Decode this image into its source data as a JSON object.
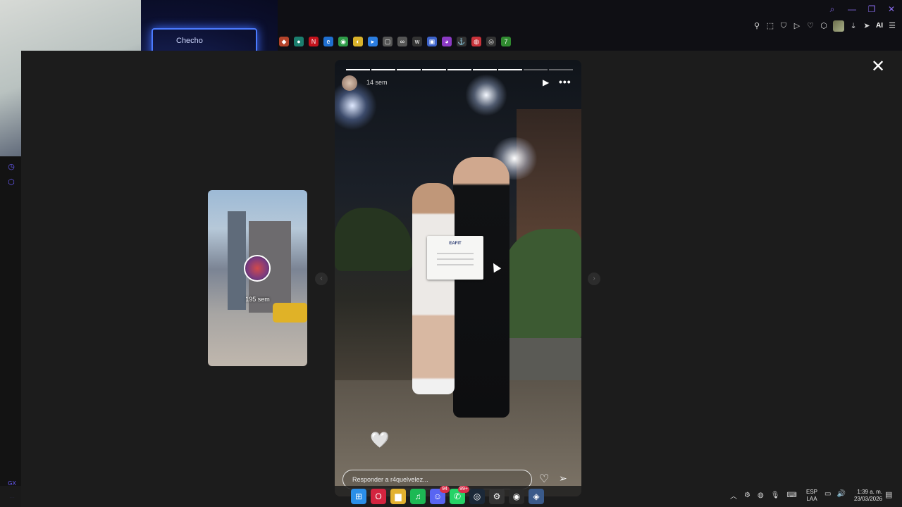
{
  "window_controls": [
    {
      "name": "search-icon",
      "glyph": "⌕"
    },
    {
      "name": "minimize-icon",
      "glyph": "—"
    },
    {
      "name": "restore-icon",
      "glyph": "❐"
    },
    {
      "name": "close-window-icon",
      "glyph": "✕"
    }
  ],
  "toolbar": {
    "icons": [
      {
        "name": "pin-icon",
        "glyph": "⚲"
      },
      {
        "name": "snapshot-icon",
        "glyph": "⬚"
      },
      {
        "name": "shield-icon",
        "glyph": "⛉"
      },
      {
        "name": "play-icon",
        "glyph": "▷"
      },
      {
        "name": "heart-icon",
        "glyph": "♡"
      },
      {
        "name": "extensions-icon",
        "glyph": "⬡"
      }
    ],
    "ai_label": "AI",
    "menu_glyph": "☰",
    "download_glyph": "⤓",
    "send_glyph": "➤"
  },
  "bookmarks": [
    {
      "name": "bookmark-a-icon",
      "glyph": "◆",
      "color": "#b4432a"
    },
    {
      "name": "bookmark-b-icon",
      "glyph": "●",
      "color": "#1b7e6e"
    },
    {
      "name": "netflix-icon",
      "glyph": "N",
      "color": "#c4121c"
    },
    {
      "name": "edge-icon",
      "glyph": "e",
      "color": "#1f6fd1"
    },
    {
      "name": "chrome-icon",
      "glyph": "◉",
      "color": "#2e9b48"
    },
    {
      "name": "bookmark-c-icon",
      "glyph": "◐",
      "color": "#d9b22a"
    },
    {
      "name": "bookmark-d-icon",
      "glyph": "▸",
      "color": "#2b7de0"
    },
    {
      "name": "file-icon",
      "glyph": "▢",
      "color": "#555555"
    },
    {
      "name": "link-icon",
      "glyph": "∞",
      "color": "#555555"
    },
    {
      "name": "bookmark-e-icon",
      "glyph": "ᴡ",
      "color": "#333333"
    },
    {
      "name": "bookmark-f-icon",
      "glyph": "▣",
      "color": "#3c62c9"
    },
    {
      "name": "bookmark-g-icon",
      "glyph": "◕",
      "color": "#8b3ac4"
    },
    {
      "name": "anchor-icon",
      "glyph": "⚓",
      "color": "#333333"
    },
    {
      "name": "bookmark-h-icon",
      "glyph": "◍",
      "color": "#c8323a"
    },
    {
      "name": "bookmark-i-icon",
      "glyph": "◎",
      "color": "#333333"
    },
    {
      "name": "bookmark-j-icon",
      "glyph": "7",
      "color": "#2f8a2f"
    }
  ],
  "webcam": {
    "neon_text": "Checho"
  },
  "sidebar": {
    "icons": [
      {
        "name": "history-icon",
        "glyph": "◷"
      },
      {
        "name": "extensions-side-icon",
        "glyph": "⬡"
      }
    ],
    "bottom_label": "GX",
    "more_label": "···"
  },
  "side_story": {
    "time_label": "195 sem"
  },
  "nav": {
    "prev_glyph": "‹",
    "next_glyph": "›"
  },
  "story": {
    "time": "14 sem",
    "progress_segments": [
      true,
      true,
      true,
      true,
      true,
      true,
      true,
      false,
      false
    ],
    "play_glyph": "▶",
    "more_glyph": "•••",
    "certificate_title": "EAFIT",
    "heart_sticker": "🤍",
    "reply_placeholder": "Responder a r4quelvelez...",
    "like_glyph": "♡",
    "share_glyph": "➢"
  },
  "close_glyph": "✕",
  "taskbar": {
    "apps": [
      {
        "name": "windows-start-icon",
        "glyph": "⊞",
        "color": "#2b8fe8",
        "badge": ""
      },
      {
        "name": "opera-gx-icon",
        "glyph": "O",
        "color": "#d3243f",
        "badge": ""
      },
      {
        "name": "file-explorer-icon",
        "glyph": "▆",
        "color": "#e3b12f",
        "badge": ""
      },
      {
        "name": "spotify-icon",
        "glyph": "♫",
        "color": "#1db954",
        "badge": ""
      },
      {
        "name": "discord-icon",
        "glyph": "☺",
        "color": "#5865f2",
        "badge": "94"
      },
      {
        "name": "whatsapp-icon",
        "glyph": "✆",
        "color": "#25d366",
        "badge": "99+"
      },
      {
        "name": "steam-icon",
        "glyph": "◎",
        "color": "#1b2838",
        "badge": ""
      },
      {
        "name": "settings-icon",
        "glyph": "⚙",
        "color": "#333333",
        "badge": ""
      },
      {
        "name": "obs-icon",
        "glyph": "◉",
        "color": "#2a2a2a",
        "badge": ""
      },
      {
        "name": "steam-active-icon",
        "glyph": "◈",
        "color": "#3a5a8a",
        "badge": ""
      }
    ],
    "tray_icons": [
      {
        "name": "tray-chevron-icon",
        "glyph": "︿"
      },
      {
        "name": "tray-gear-icon",
        "glyph": "⚙"
      },
      {
        "name": "tray-wifi-icon",
        "glyph": "◍"
      },
      {
        "name": "microphone-icon",
        "glyph": "🎙"
      },
      {
        "name": "keyboard-icon",
        "glyph": "⌨"
      }
    ],
    "lang_line1": "ESP",
    "lang_line2": "LAA",
    "tray_icons2": [
      {
        "name": "display-icon",
        "glyph": "▭"
      },
      {
        "name": "volume-icon",
        "glyph": "🔊"
      }
    ],
    "clock_time": "1:39 a. m.",
    "clock_date": "23/03/2026",
    "notification_glyph": "▤"
  }
}
